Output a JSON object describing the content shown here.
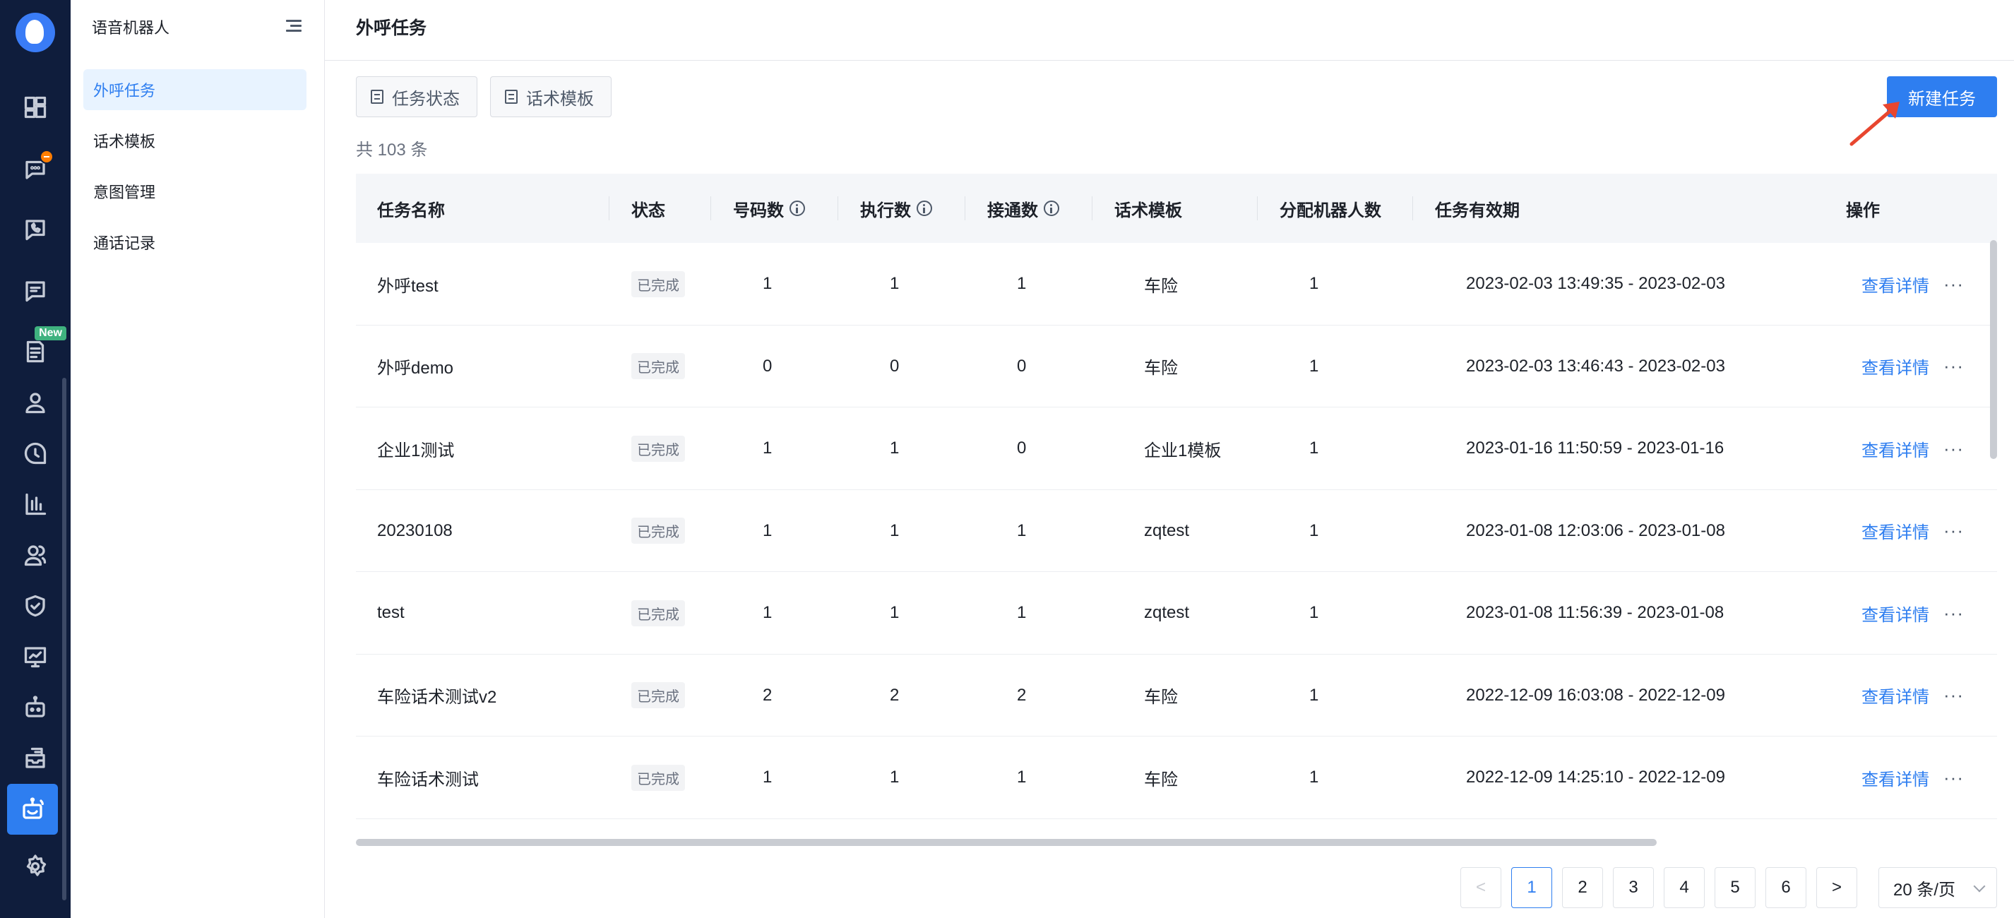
{
  "rail": {
    "new_badge": "New"
  },
  "sidebar": {
    "title": "语音机器人",
    "items": [
      {
        "label": "外呼任务"
      },
      {
        "label": "话术模板"
      },
      {
        "label": "意图管理"
      },
      {
        "label": "通话记录"
      }
    ]
  },
  "header": {
    "title": "外呼任务"
  },
  "toolbar": {
    "tab_status": "任务状态",
    "tab_template": "话术模板",
    "new_task": "新建任务"
  },
  "total_text": "共 103 条",
  "table": {
    "columns": [
      "任务名称",
      "状态",
      "号码数",
      "执行数",
      "接通数",
      "话术模板",
      "分配机器人数",
      "任务有效期",
      "操作"
    ],
    "rows": [
      {
        "name": "外呼test",
        "status": "已完成",
        "numbers": "1",
        "executed": "1",
        "connected": "1",
        "template": "车险",
        "robots": "1",
        "period": "2023-02-03 13:49:35 - 2023-02-03",
        "action": "查看详情"
      },
      {
        "name": "外呼demo",
        "status": "已完成",
        "numbers": "0",
        "executed": "0",
        "connected": "0",
        "template": "车险",
        "robots": "1",
        "period": "2023-02-03 13:46:43 - 2023-02-03",
        "action": "查看详情"
      },
      {
        "name": "企业1测试",
        "status": "已完成",
        "numbers": "1",
        "executed": "1",
        "connected": "0",
        "template": "企业1模板",
        "robots": "1",
        "period": "2023-01-16 11:50:59 - 2023-01-16",
        "action": "查看详情"
      },
      {
        "name": "20230108",
        "status": "已完成",
        "numbers": "1",
        "executed": "1",
        "connected": "1",
        "template": "zqtest",
        "robots": "1",
        "period": "2023-01-08 12:03:06 - 2023-01-08",
        "action": "查看详情"
      },
      {
        "name": "test",
        "status": "已完成",
        "numbers": "1",
        "executed": "1",
        "connected": "1",
        "template": "zqtest",
        "robots": "1",
        "period": "2023-01-08 11:56:39 - 2023-01-08",
        "action": "查看详情"
      },
      {
        "name": "车险话术测试v2",
        "status": "已完成",
        "numbers": "2",
        "executed": "2",
        "connected": "2",
        "template": "车险",
        "robots": "1",
        "period": "2022-12-09 16:03:08 - 2022-12-09",
        "action": "查看详情"
      },
      {
        "name": "车险话术测试",
        "status": "已完成",
        "numbers": "1",
        "executed": "1",
        "connected": "1",
        "template": "车险",
        "robots": "1",
        "period": "2022-12-09 14:25:10 - 2022-12-09",
        "action": "查看详情"
      }
    ],
    "more_label": "···"
  },
  "pagination": {
    "prev": "<",
    "pages": [
      "1",
      "2",
      "3",
      "4",
      "5",
      "6"
    ],
    "current": "1",
    "next": ">",
    "page_size": "20 条/页"
  },
  "colors": {
    "primary": "#2e7ef0",
    "rail_bg": "#0f1d3c",
    "new_badge": "#3fb27f",
    "notify_badge": "#ff7d00",
    "arrow": "#e8462f"
  }
}
